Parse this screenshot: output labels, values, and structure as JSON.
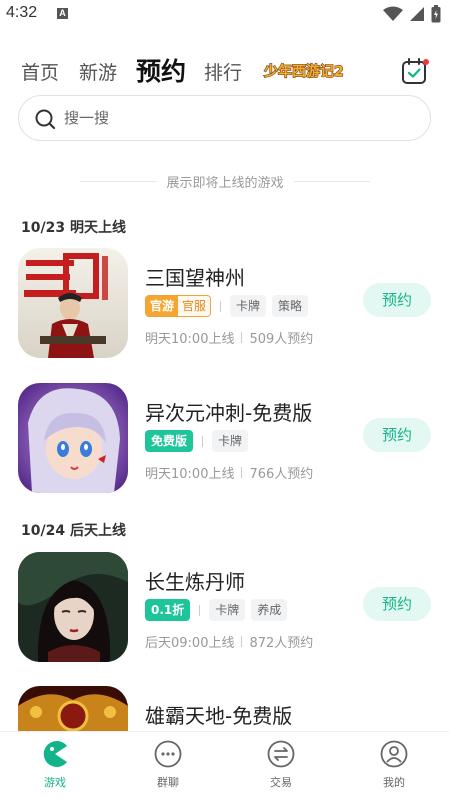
{
  "status_bar": {
    "time": "4:32",
    "notification_badge": "A"
  },
  "top_tabs": [
    {
      "label": "首页",
      "active": false
    },
    {
      "label": "新游",
      "active": false
    },
    {
      "label": "预约",
      "active": true
    },
    {
      "label": "排行",
      "active": false
    }
  ],
  "banner": {
    "logo_text": "少年西游记2"
  },
  "search": {
    "placeholder": "搜一搜"
  },
  "section_hint": "展示即将上线的游戏",
  "groups": [
    {
      "date": "10/23 明天上线",
      "games": [
        {
          "name": "三国望神州",
          "official_tags": [
            "官游",
            "官服"
          ],
          "tags": [
            "卡牌",
            "策略"
          ],
          "release": "明天10:00上线",
          "reservations": "509人预约",
          "action": "预约"
        },
        {
          "name": "异次元冲刺-免费版",
          "badge": "免费版",
          "tags": [
            "卡牌"
          ],
          "release": "明天10:00上线",
          "reservations": "766人预约",
          "action": "预约"
        }
      ]
    },
    {
      "date": "10/24 后天上线",
      "games": [
        {
          "name": "长生炼丹师",
          "badge": "0.1折",
          "tags": [
            "卡牌",
            "养成"
          ],
          "release": "后天09:00上线",
          "reservations": "872人预约",
          "action": "预约"
        },
        {
          "name": "雄霸天地-免费版"
        }
      ]
    }
  ],
  "bottom_nav": [
    {
      "label": "游戏",
      "icon": "pacman-icon",
      "active": true
    },
    {
      "label": "群聊",
      "icon": "chat-dots-icon",
      "active": false
    },
    {
      "label": "交易",
      "icon": "exchange-icon",
      "active": false
    },
    {
      "label": "我的",
      "icon": "user-icon",
      "active": false
    }
  ],
  "colors": {
    "accent": "#14b48a",
    "accent_bg": "#e3f8f2",
    "official_orange": "#f6a630"
  }
}
